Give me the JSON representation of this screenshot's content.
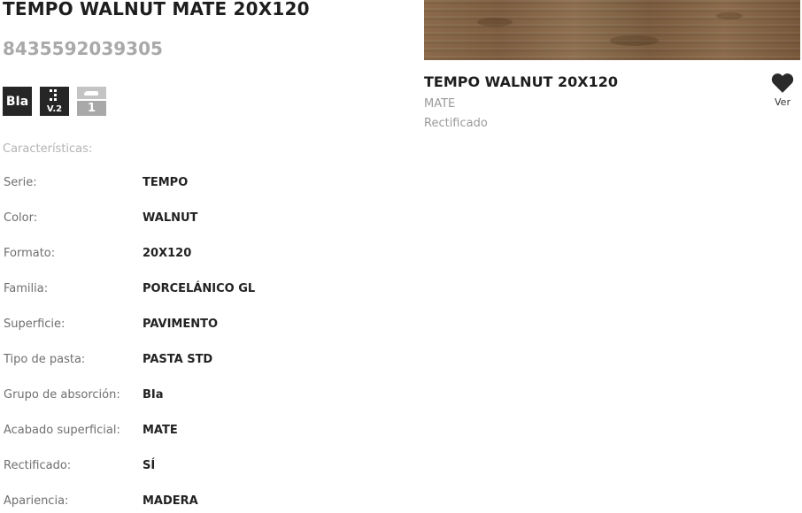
{
  "product": {
    "title": "TEMPO WALNUT MATE 20X120",
    "ean": "8435592039305"
  },
  "badges": {
    "absorption_group": "BIa",
    "slip_version": "V.2",
    "traffic_class": "1"
  },
  "specs": {
    "heading": "Características:",
    "rows": [
      {
        "label": "Serie:",
        "value": "TEMPO"
      },
      {
        "label": "Color:",
        "value": "WALNUT"
      },
      {
        "label": "Formato:",
        "value": "20X120"
      },
      {
        "label": "Familia:",
        "value": "PORCELÁNICO GL"
      },
      {
        "label": "Superficie:",
        "value": "PAVIMENTO"
      },
      {
        "label": "Tipo de pasta:",
        "value": "PASTA STD"
      },
      {
        "label": "Grupo de absorción:",
        "value": "BIa"
      },
      {
        "label": "Acabado superficial:",
        "value": "MATE"
      },
      {
        "label": "Rectificado:",
        "value": "SÍ"
      },
      {
        "label": "Apariencia:",
        "value": "MADERA"
      }
    ]
  },
  "card": {
    "title": "TEMPO WALNUT 20X120",
    "finish": "MATE",
    "rectified": "Rectificado",
    "favorite_label": "Ver",
    "favorite_icon": "heart-icon"
  }
}
